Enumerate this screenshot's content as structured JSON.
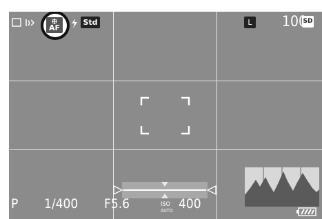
{
  "top_bar": {
    "style_label": "Std",
    "af_label": "AF",
    "image_size": "L",
    "frames_remaining": "100",
    "card_label": "SD"
  },
  "bottom_bar": {
    "mode": "P",
    "shutter": "1/400",
    "aperture": "F5.6",
    "iso_label": "ISO",
    "iso_auto": "AUTO",
    "iso_value": "400"
  },
  "level_gauge": {
    "tilt": 0
  },
  "colors": {
    "screen_bg": "#8b8b8b",
    "highlight_ring": "#111111",
    "text": "#ffffff"
  },
  "icons": [
    "frame-mode-icon",
    "stabilizer-icon",
    "af-area-icon",
    "flash-icon",
    "level-gauge-icon",
    "histogram-icon",
    "battery-icon"
  ]
}
